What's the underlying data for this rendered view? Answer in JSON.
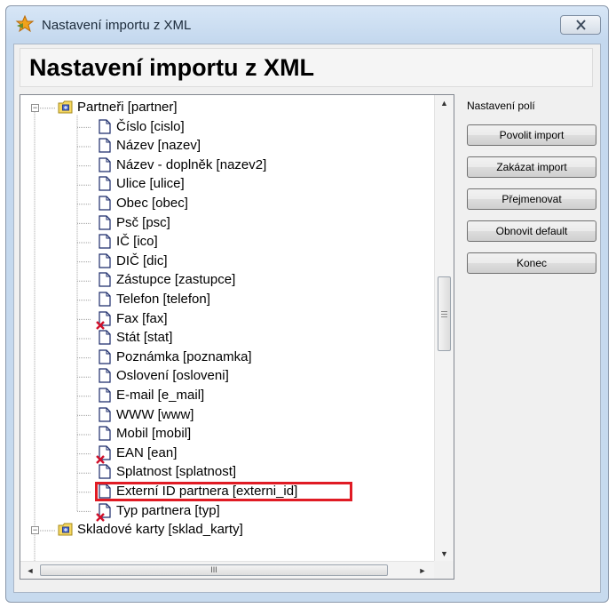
{
  "window": {
    "title": "Nastavení importu z XML"
  },
  "header": {
    "title": "Nastavení importu z XML"
  },
  "side": {
    "label": "Nastavení polí",
    "buttons": [
      {
        "label": "Povolit import"
      },
      {
        "label": "Zakázat import"
      },
      {
        "label": "Přejmenovat"
      },
      {
        "label": "Obnovit default"
      },
      {
        "label": "Konec"
      }
    ]
  },
  "tree": {
    "root_nodes": [
      {
        "label": "Partneři [partner]",
        "expanded": true
      },
      {
        "label": "Skladové karty [sklad_karty]",
        "expanded": true
      }
    ],
    "children": [
      {
        "label": "Číslo [cislo]",
        "enabled": true
      },
      {
        "label": "Název [nazev]",
        "enabled": true
      },
      {
        "label": "Název - doplněk [nazev2]",
        "enabled": true
      },
      {
        "label": "Ulice [ulice]",
        "enabled": true
      },
      {
        "label": "Obec [obec]",
        "enabled": true
      },
      {
        "label": "Psč [psc]",
        "enabled": true
      },
      {
        "label": "IČ [ico]",
        "enabled": true
      },
      {
        "label": "DIČ [dic]",
        "enabled": true
      },
      {
        "label": "Zástupce [zastupce]",
        "enabled": true
      },
      {
        "label": "Telefon [telefon]",
        "enabled": true
      },
      {
        "label": "Fax [fax]",
        "enabled": false
      },
      {
        "label": "Stát [stat]",
        "enabled": true
      },
      {
        "label": "Poznámka [poznamka]",
        "enabled": true
      },
      {
        "label": "Oslovení [osloveni]",
        "enabled": true
      },
      {
        "label": "E-mail [e_mail]",
        "enabled": true
      },
      {
        "label": "WWW [www]",
        "enabled": true
      },
      {
        "label": "Mobil [mobil]",
        "enabled": true
      },
      {
        "label": "EAN [ean]",
        "enabled": false
      },
      {
        "label": "Splatnost [splatnost]",
        "enabled": true
      },
      {
        "label": "Externí ID partnera [externi_id]",
        "enabled": true
      },
      {
        "label": "Typ partnera [typ]",
        "enabled": false
      }
    ]
  },
  "scrollbar": {
    "h_grip": "III"
  },
  "colors": {
    "highlight": "#e01b24",
    "title_text": "#1b2a3a",
    "disabled_mark": "#d0102a"
  }
}
